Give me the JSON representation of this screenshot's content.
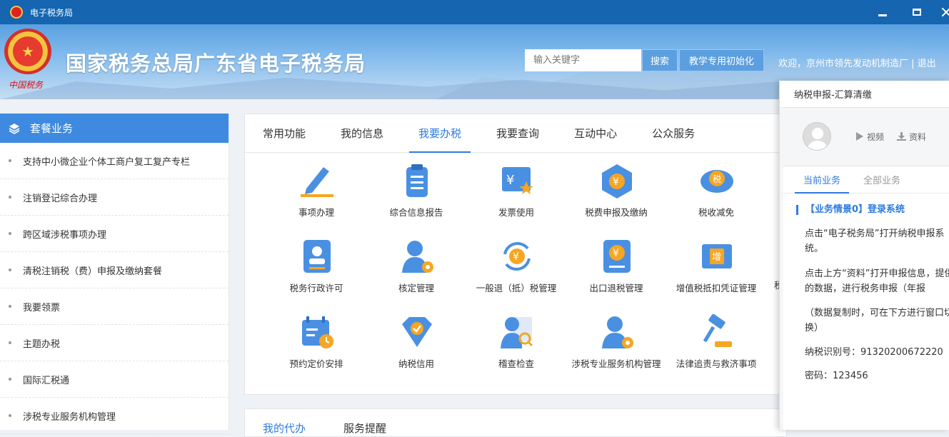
{
  "window": {
    "title": "电子税务局",
    "controls": [
      "minimize",
      "maximize",
      "close"
    ]
  },
  "header": {
    "site_title": "国家税务总局广东省电子税务局",
    "search_placeholder": "输入关键字",
    "search_button": "搜索",
    "init_button": "教学专用初始化",
    "welcome_text": "欢迎，京州市领先发动机制造厂 | 退出",
    "emblem_text": "中国税务"
  },
  "sidebar": {
    "title": "套餐业务",
    "items": [
      {
        "label": "支持中小微企业个体工商户复工复产专栏"
      },
      {
        "label": "注销登记综合办理"
      },
      {
        "label": "跨区域涉税事项办理"
      },
      {
        "label": "清税注销税（费）申报及缴纳套餐"
      },
      {
        "label": "我要领票"
      },
      {
        "label": "主题办税"
      },
      {
        "label": "国际汇税通"
      },
      {
        "label": "涉税专业服务机构管理"
      }
    ]
  },
  "main": {
    "tabs": [
      {
        "label": "常用功能",
        "active": false
      },
      {
        "label": "我的信息",
        "active": false
      },
      {
        "label": "我要办税",
        "active": true
      },
      {
        "label": "我要查询",
        "active": false
      },
      {
        "label": "互动中心",
        "active": false
      },
      {
        "label": "公众服务",
        "active": false
      }
    ],
    "functions": [
      {
        "label": "事项办理",
        "icon": "pencil-icon"
      },
      {
        "label": "综合信息报告",
        "icon": "clipboard-icon"
      },
      {
        "label": "发票使用",
        "icon": "invoice-icon"
      },
      {
        "label": "税费申报及缴纳",
        "icon": "tax-cube-icon"
      },
      {
        "label": "税收减免",
        "icon": "tax-reduction-icon"
      },
      {
        "label": "税务行政许可",
        "icon": "license-icon"
      },
      {
        "label": "核定管理",
        "icon": "user-gear-icon"
      },
      {
        "label": "一般退（抵）税管理",
        "icon": "refund-cycle-icon"
      },
      {
        "label": "出口退税管理",
        "icon": "export-refund-icon"
      },
      {
        "label": "增值税抵扣凭证管理",
        "icon": "vat-voucher-icon"
      },
      {
        "label": "预约定价安排",
        "icon": "calendar-clock-icon"
      },
      {
        "label": "纳税信用",
        "icon": "credit-diamond-icon"
      },
      {
        "label": "稽查检查",
        "icon": "inspection-icon"
      },
      {
        "label": "涉税专业服务机构管理",
        "icon": "agency-gear-icon"
      },
      {
        "label": "法律追责与救济事项",
        "icon": "gavel-icon"
      }
    ],
    "partial_label_col6_row2": "税"
  },
  "bottom_panel": {
    "tabs": [
      {
        "label": "我的代办",
        "active": true
      },
      {
        "label": "服务提醒",
        "active": false
      }
    ]
  },
  "popup": {
    "title": "纳税申报-汇算清缴",
    "video_label": "视频",
    "material_label": "资料",
    "tabs": [
      {
        "label": "当前业务",
        "active": true
      },
      {
        "label": "全部业务",
        "active": false
      }
    ],
    "scene_title": "【业务情景0】登录系统",
    "paragraphs": [
      "点击“电子税务局”打开纳税申报系统。",
      "点击上方“资料”打开申报信息，提供的数据，进行税务申报（年报",
      "（数据复制时，可在下方进行窗口切换）",
      "纳税识别号：91320200672220",
      "密码：123456"
    ]
  },
  "colors": {
    "titlebar": "#1565b0",
    "accent": "#2d7be0",
    "sidebar_head": "#3d8ae0"
  }
}
